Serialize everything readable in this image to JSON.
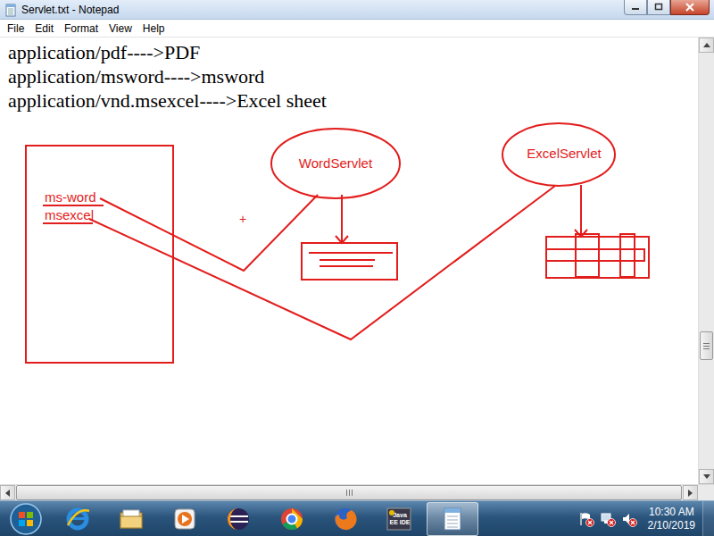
{
  "window": {
    "title": "Servlet.txt - Notepad"
  },
  "menu": [
    "File",
    "Edit",
    "Format",
    "View",
    "Help"
  ],
  "document": {
    "lines": [
      "application/pdf---->PDF",
      "application/msword---->msword",
      "application/vnd.msexcel---->Excel sheet"
    ]
  },
  "diagram": {
    "page_items": [
      {
        "label": "ms-word"
      },
      {
        "label": "msexcel"
      }
    ],
    "servlets": [
      {
        "label": "WordServlet",
        "kind": "document"
      },
      {
        "label": "ExcelServlet",
        "kind": "sheet"
      }
    ],
    "cursor": "+"
  },
  "scroll": {
    "vertical_level": 0.72
  },
  "taskbar": {
    "apps": [
      {
        "kind": "ie",
        "selected": false
      },
      {
        "kind": "explorer",
        "selected": false
      },
      {
        "kind": "media",
        "selected": false
      },
      {
        "kind": "eclipse",
        "selected": false
      },
      {
        "kind": "chrome",
        "selected": false
      },
      {
        "kind": "firefox",
        "selected": false
      },
      {
        "kind": "javaee",
        "label": "Java EE IDE",
        "selected": false
      },
      {
        "kind": "notepad",
        "selected": true
      }
    ],
    "tray": [
      {
        "kind": "flag",
        "alert": true
      },
      {
        "kind": "network",
        "alert": true
      },
      {
        "kind": "volume",
        "alert": true
      }
    ],
    "clock": {
      "time": "10:30 AM",
      "date": "2/10/2019"
    }
  }
}
